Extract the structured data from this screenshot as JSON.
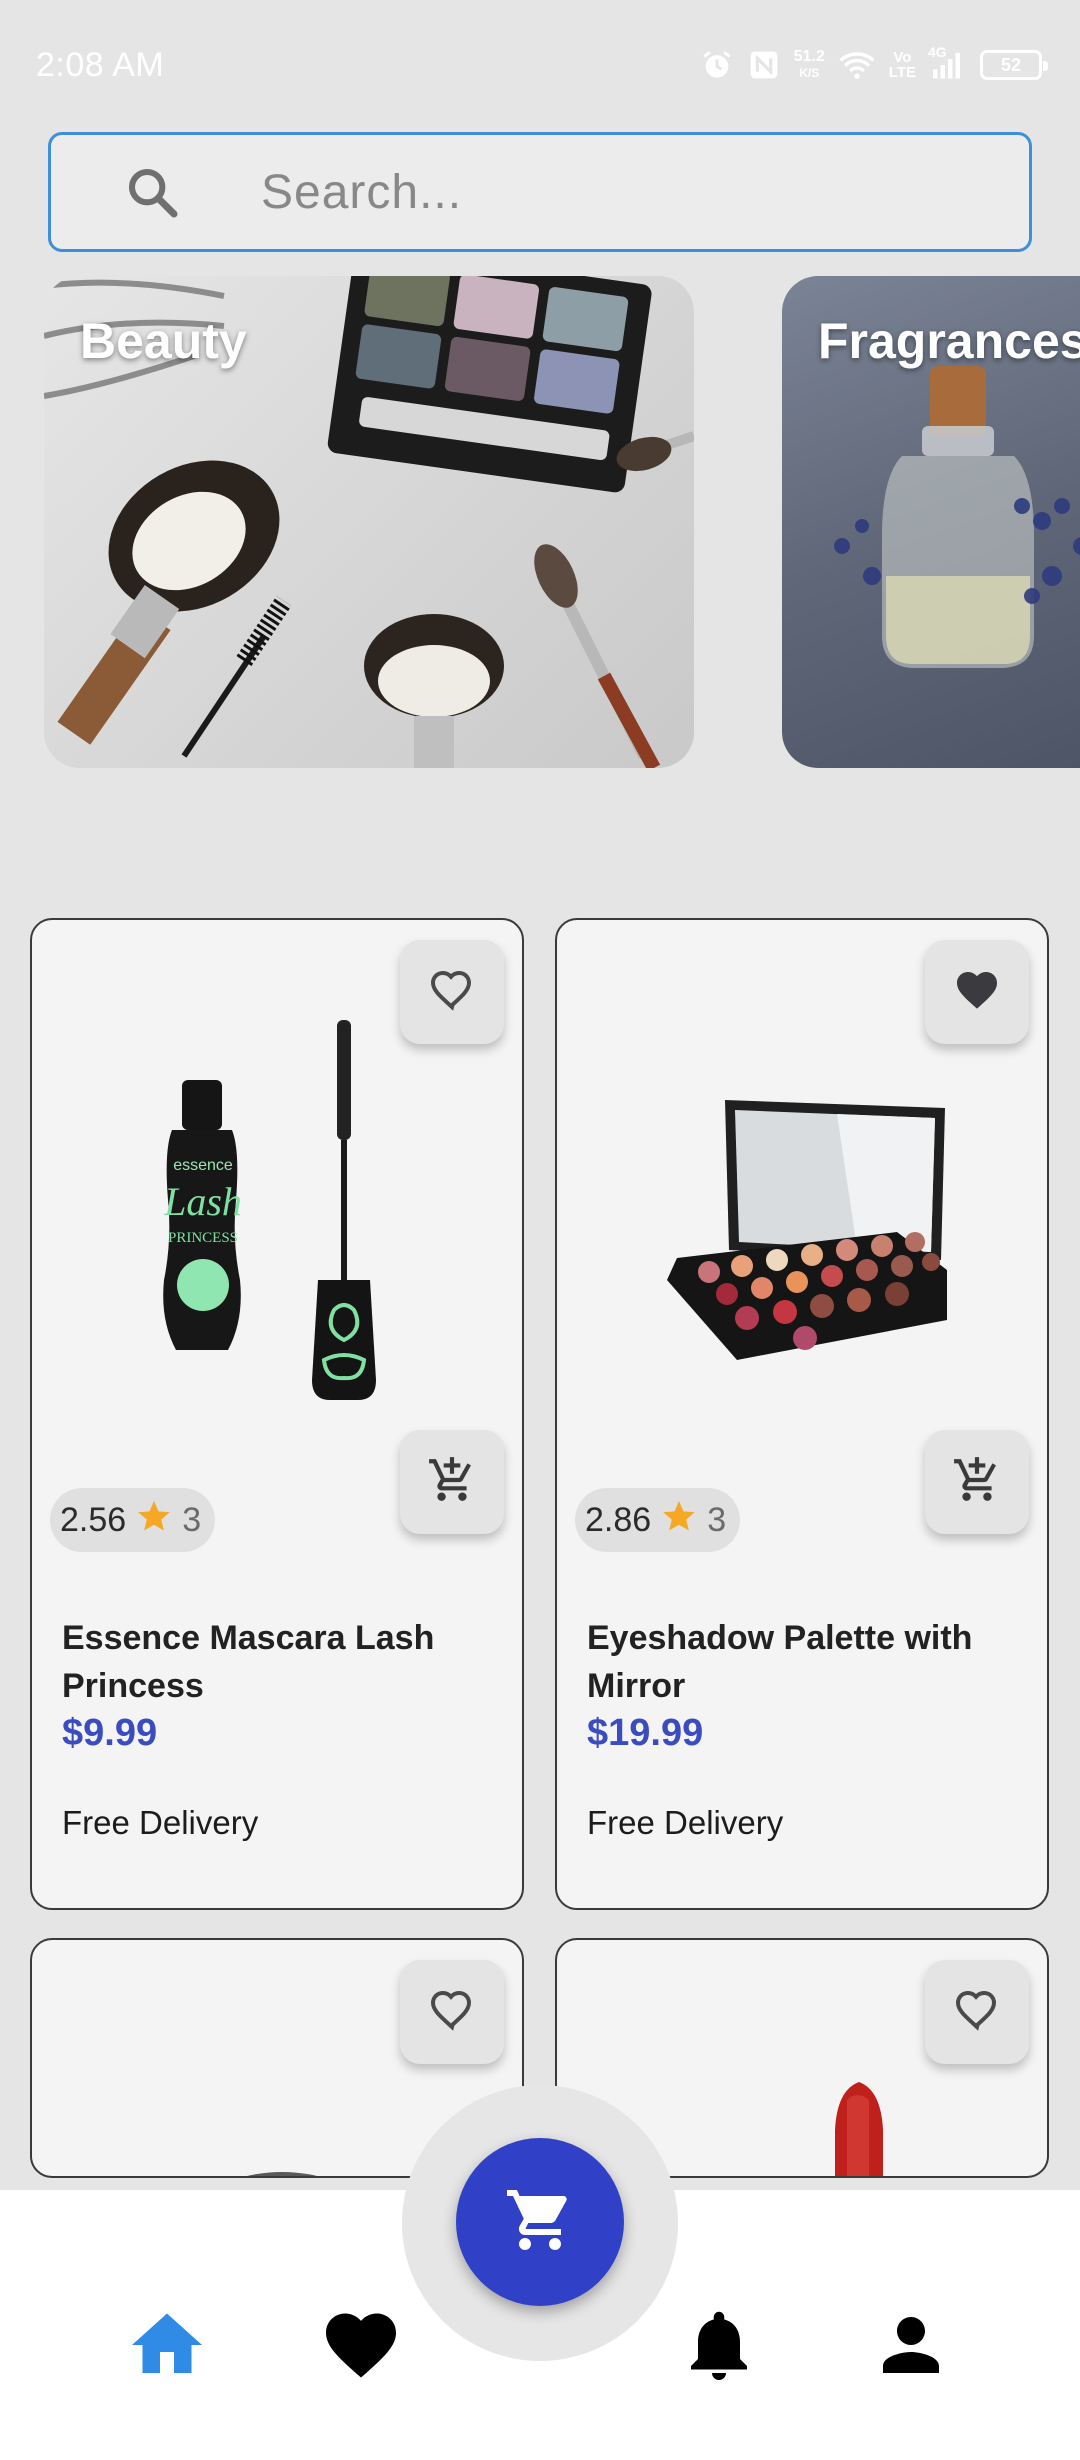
{
  "status_bar": {
    "time": "2:08 AM",
    "net_speed": "51.2",
    "net_speed_unit": "K/S",
    "volte_top": "Vo",
    "volte_bottom": "LTE",
    "network": "4G",
    "battery": "52"
  },
  "search": {
    "placeholder": "Search..."
  },
  "categories": [
    {
      "label": "Beauty"
    },
    {
      "label": "Fragrances"
    }
  ],
  "products": [
    {
      "name": "Essence Mascara Lash Princess",
      "price": "$9.99",
      "rating": "2.56",
      "rating_count": "3",
      "delivery": "Free Delivery",
      "favorited": false
    },
    {
      "name": "Eyeshadow Palette with Mirror",
      "price": "$19.99",
      "rating": "2.86",
      "rating_count": "3",
      "delivery": "Free Delivery",
      "favorited": true
    },
    {
      "favorited": false
    },
    {
      "favorited": false
    }
  ],
  "colors": {
    "accent_blue": "#3d8fdc",
    "price_blue": "#3b4bc0",
    "fab_blue": "#3141c7",
    "star": "#f4a825",
    "home_active": "#2f8be6"
  },
  "icons": {
    "search": "search-icon",
    "heart_outline": "heart-outline-icon",
    "heart_filled": "heart-filled-icon",
    "add_cart": "add-shopping-cart-icon",
    "cart": "shopping-cart-icon",
    "home": "home-icon",
    "bell": "bell-icon",
    "person": "person-icon",
    "star": "star-icon"
  }
}
